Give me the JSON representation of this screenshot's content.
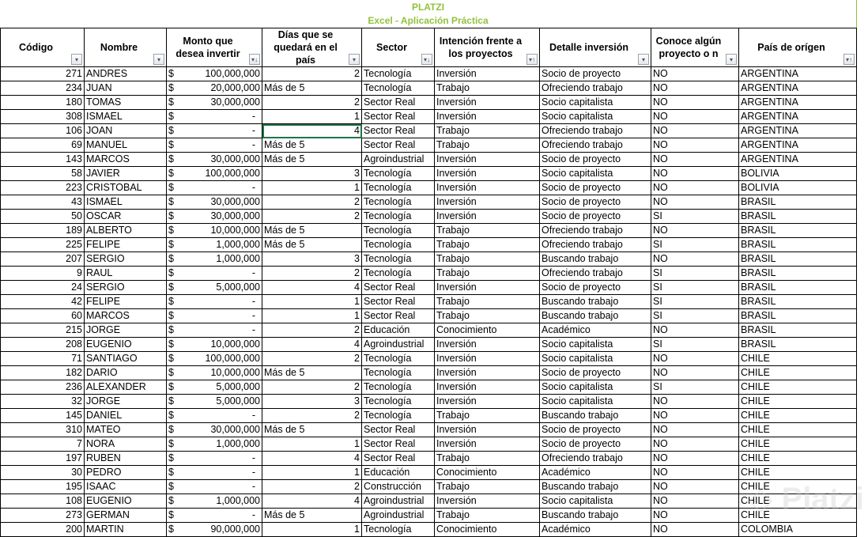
{
  "title": "PLATZI",
  "subtitle": "Excel - Aplicación Práctica",
  "watermark": "Platzi",
  "headers": [
    "Código",
    "Nombre",
    "Monto que desea invertir",
    "Días que se quedará en el país",
    "Sector",
    "Intención frente a los proyectos",
    "Detalle inversión",
    "Conoce algún proyecto o n",
    "País de orígen"
  ],
  "filter_icons": [
    "▾",
    "▾",
    "▾↓",
    "▾",
    "▾↓",
    "▾↑",
    "▾",
    "▾",
    "▾↑"
  ],
  "rows": [
    [
      "271",
      "ANDRES",
      "100,000,000",
      "2",
      "Tecnología",
      "Inversión",
      "Socio de proyecto",
      "NO",
      "ARGENTINA"
    ],
    [
      "234",
      "JUAN",
      "20,000,000",
      "Más de 5",
      "Tecnología",
      "Trabajo",
      "Ofreciendo trabajo",
      "NO",
      "ARGENTINA"
    ],
    [
      "180",
      "TOMAS",
      "30,000,000",
      "2",
      "Sector Real",
      "Inversión",
      "Socio capitalista",
      "NO",
      "ARGENTINA"
    ],
    [
      "308",
      "ISMAEL",
      "-",
      "1",
      "Sector Real",
      "Inversión",
      "Socio capitalista",
      "NO",
      "ARGENTINA"
    ],
    [
      "106",
      "JOAN",
      "-",
      "4",
      "Sector Real",
      "Trabajo",
      "Ofreciendo trabajo",
      "NO",
      "ARGENTINA"
    ],
    [
      "69",
      "MANUEL",
      "-",
      "Más de 5",
      "Sector Real",
      "Trabajo",
      "Ofreciendo trabajo",
      "NO",
      "ARGENTINA"
    ],
    [
      "143",
      "MARCOS",
      "30,000,000",
      "Más de 5",
      "Agroindustrial",
      "Inversión",
      "Socio de proyecto",
      "NO",
      "ARGENTINA"
    ],
    [
      "58",
      "JAVIER",
      "100,000,000",
      "3",
      "Tecnología",
      "Inversión",
      "Socio capitalista",
      "NO",
      "BOLIVIA"
    ],
    [
      "223",
      "CRISTOBAL",
      "-",
      "1",
      "Tecnología",
      "Inversión",
      "Socio de proyecto",
      "NO",
      "BOLIVIA"
    ],
    [
      "43",
      "ISMAEL",
      "30,000,000",
      "2",
      "Tecnología",
      "Inversión",
      "Socio de proyecto",
      "NO",
      "BRASIL"
    ],
    [
      "50",
      "OSCAR",
      "30,000,000",
      "2",
      "Tecnología",
      "Inversión",
      "Socio de proyecto",
      "SI",
      "BRASIL"
    ],
    [
      "189",
      "ALBERTO",
      "10,000,000",
      "Más de 5",
      "Tecnología",
      "Trabajo",
      "Ofreciendo trabajo",
      "NO",
      "BRASIL"
    ],
    [
      "225",
      "FELIPE",
      "1,000,000",
      "Más de 5",
      "Tecnología",
      "Trabajo",
      "Ofreciendo trabajo",
      "SI",
      "BRASIL"
    ],
    [
      "207",
      "SERGIO",
      "1,000,000",
      "3",
      "Tecnología",
      "Trabajo",
      "Buscando trabajo",
      "NO",
      "BRASIL"
    ],
    [
      "9",
      "RAUL",
      "-",
      "2",
      "Tecnología",
      "Trabajo",
      "Ofreciendo trabajo",
      "SI",
      "BRASIL"
    ],
    [
      "24",
      "SERGIO",
      "5,000,000",
      "4",
      "Sector Real",
      "Inversión",
      "Socio de proyecto",
      "SI",
      "BRASIL"
    ],
    [
      "42",
      "FELIPE",
      "-",
      "1",
      "Sector Real",
      "Trabajo",
      "Buscando trabajo",
      "SI",
      "BRASIL"
    ],
    [
      "60",
      "MARCOS",
      "-",
      "1",
      "Sector Real",
      "Trabajo",
      "Buscando trabajo",
      "SI",
      "BRASIL"
    ],
    [
      "215",
      "JORGE",
      "-",
      "2",
      "Educación",
      "Conocimiento",
      "Académico",
      "NO",
      "BRASIL"
    ],
    [
      "208",
      "EUGENIO",
      "10,000,000",
      "4",
      "Agroindustrial",
      "Inversión",
      "Socio capitalista",
      "SI",
      "BRASIL"
    ],
    [
      "71",
      "SANTIAGO",
      "100,000,000",
      "2",
      "Tecnología",
      "Inversión",
      "Socio capitalista",
      "NO",
      "CHILE"
    ],
    [
      "182",
      "DARIO",
      "10,000,000",
      "Más de 5",
      "Tecnología",
      "Inversión",
      "Socio de proyecto",
      "NO",
      "CHILE"
    ],
    [
      "236",
      "ALEXANDER",
      "5,000,000",
      "2",
      "Tecnología",
      "Inversión",
      "Socio capitalista",
      "SI",
      "CHILE"
    ],
    [
      "32",
      "JORGE",
      "5,000,000",
      "3",
      "Tecnología",
      "Inversión",
      "Socio capitalista",
      "NO",
      "CHILE"
    ],
    [
      "145",
      "DANIEL",
      "-",
      "2",
      "Tecnología",
      "Trabajo",
      "Buscando trabajo",
      "NO",
      "CHILE"
    ],
    [
      "310",
      "MATEO",
      "30,000,000",
      "Más de 5",
      "Sector Real",
      "Inversión",
      "Socio de proyecto",
      "NO",
      "CHILE"
    ],
    [
      "7",
      "NORA",
      "1,000,000",
      "1",
      "Sector Real",
      "Inversión",
      "Socio de proyecto",
      "NO",
      "CHILE"
    ],
    [
      "197",
      "RUBEN",
      "-",
      "4",
      "Sector Real",
      "Trabajo",
      "Ofreciendo trabajo",
      "NO",
      "CHILE"
    ],
    [
      "30",
      "PEDRO",
      "-",
      "1",
      "Educación",
      "Conocimiento",
      "Académico",
      "NO",
      "CHILE"
    ],
    [
      "195",
      "ISAAC",
      "-",
      "2",
      "Construcción",
      "Trabajo",
      "Buscando trabajo",
      "NO",
      "CHILE"
    ],
    [
      "108",
      "EUGENIO",
      "1,000,000",
      "4",
      "Agroindustrial",
      "Inversión",
      "Socio capitalista",
      "NO",
      "CHILE"
    ],
    [
      "273",
      "GERMAN",
      "-",
      "Más de 5",
      "Agroindustrial",
      "Trabajo",
      "Buscando trabajo",
      "NO",
      "CHILE"
    ],
    [
      "200",
      "MARTIN",
      "90,000,000",
      "1",
      "Tecnología",
      "Conocimiento",
      "Académico",
      "NO",
      "COLOMBIA"
    ]
  ],
  "currency": "$"
}
